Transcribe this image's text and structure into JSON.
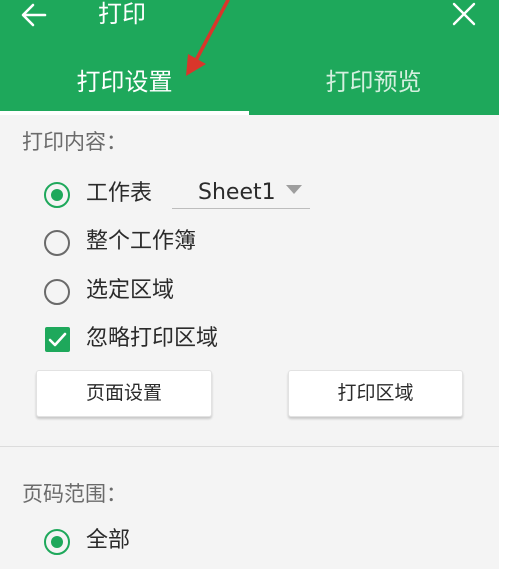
{
  "colors": {
    "accent": "#1ea85b",
    "annotation_arrow": "#d9362b"
  },
  "header": {
    "title": "打印",
    "back_icon": "arrow-left-icon",
    "close_icon": "close-icon"
  },
  "tabs": [
    {
      "label": "打印设置",
      "active": true
    },
    {
      "label": "打印预览",
      "active": false
    }
  ],
  "print_content": {
    "title": "打印内容：",
    "options": [
      {
        "label": "工作表",
        "checked": true
      },
      {
        "label": "整个工作簿",
        "checked": false
      },
      {
        "label": "选定区域",
        "checked": false
      }
    ],
    "sheet_select": {
      "value": "Sheet1"
    },
    "ignore_print_area": {
      "label": "忽略打印区域",
      "checked": true
    },
    "buttons": {
      "page_setup": "页面设置",
      "print_area": "打印区域"
    }
  },
  "page_range": {
    "title": "页码范围：",
    "options": [
      {
        "label": "全部",
        "checked": true
      }
    ]
  }
}
